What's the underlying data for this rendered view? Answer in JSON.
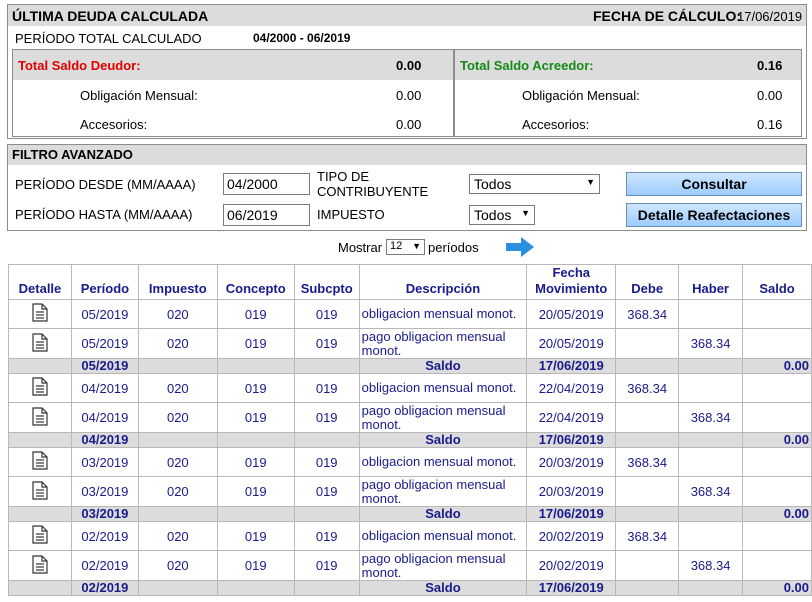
{
  "debt": {
    "title": "ÚLTIMA DEUDA CALCULADA",
    "fecha_label": "FECHA DE CÁLCULO:",
    "fecha_value": "17/06/2019",
    "periodo_label": "PERÍODO TOTAL CALCULADO",
    "periodo_value": "04/2000 - 06/2019",
    "deudor": {
      "label": "Total Saldo Deudor:",
      "total": "0.00",
      "obligacion_label": "Obligación Mensual:",
      "obligacion": "0.00",
      "accesorios_label": "Accesorios:",
      "accesorios": "0.00"
    },
    "acreedor": {
      "label": "Total Saldo Acreedor:",
      "total": "0.16",
      "obligacion_label": "Obligación Mensual:",
      "obligacion": "0.00",
      "accesorios_label": "Accesorios:",
      "accesorios": "0.16"
    },
    "colors": {
      "deudor": "#e00000",
      "acreedor": "#168a16"
    }
  },
  "filter": {
    "title": "FILTRO AVANZADO",
    "desde_label": "PERÍODO DESDE (MM/AAAA)",
    "desde_value": "04/2000",
    "hasta_label": "PERÍODO HASTA (MM/AAAA)",
    "hasta_value": "06/2019",
    "tipo_label_1": "TIPO DE",
    "tipo_label_2": "CONTRIBUYENTE",
    "tipo_value": "Todos",
    "impuesto_label": "IMPUESTO",
    "impuesto_value": "Todos",
    "consultar": "Consultar",
    "reafectaciones": "Detalle Reafectaciones"
  },
  "paging": {
    "mostrar": "Mostrar",
    "count": "12",
    "periodos": "períodos",
    "next_icon": "arrow-right-icon"
  },
  "table": {
    "headers": {
      "detalle": "Detalle",
      "periodo": "Período",
      "impuesto": "Impuesto",
      "concepto": "Concepto",
      "subcpto": "Subcpto",
      "descripcion": "Descripción",
      "fecha_1": "Fecha",
      "fecha_2": "Movimiento",
      "debe": "Debe",
      "haber": "Haber",
      "saldo": "Saldo"
    },
    "groups": [
      {
        "rows": [
          {
            "periodo": "05/2019",
            "impuesto": "020",
            "concepto": "019",
            "subcpto": "019",
            "descripcion": "obligacion mensual monot.",
            "fecha": "20/05/2019",
            "debe": "368.34",
            "haber": "",
            "saldo": ""
          },
          {
            "periodo": "05/2019",
            "impuesto": "020",
            "concepto": "019",
            "subcpto": "019",
            "descripcion": "pago obligacion mensual monot.",
            "fecha": "20/05/2019",
            "debe": "",
            "haber": "368.34",
            "saldo": ""
          }
        ],
        "saldo": {
          "periodo": "05/2019",
          "label": "Saldo",
          "fecha": "17/06/2019",
          "value": "0.00"
        }
      },
      {
        "rows": [
          {
            "periodo": "04/2019",
            "impuesto": "020",
            "concepto": "019",
            "subcpto": "019",
            "descripcion": "obligacion mensual monot.",
            "fecha": "22/04/2019",
            "debe": "368.34",
            "haber": "",
            "saldo": ""
          },
          {
            "periodo": "04/2019",
            "impuesto": "020",
            "concepto": "019",
            "subcpto": "019",
            "descripcion": "pago obligacion mensual monot.",
            "fecha": "22/04/2019",
            "debe": "",
            "haber": "368.34",
            "saldo": ""
          }
        ],
        "saldo": {
          "periodo": "04/2019",
          "label": "Saldo",
          "fecha": "17/06/2019",
          "value": "0.00"
        }
      },
      {
        "rows": [
          {
            "periodo": "03/2019",
            "impuesto": "020",
            "concepto": "019",
            "subcpto": "019",
            "descripcion": "obligacion mensual monot.",
            "fecha": "20/03/2019",
            "debe": "368.34",
            "haber": "",
            "saldo": ""
          },
          {
            "periodo": "03/2019",
            "impuesto": "020",
            "concepto": "019",
            "subcpto": "019",
            "descripcion": "pago obligacion mensual monot.",
            "fecha": "20/03/2019",
            "debe": "",
            "haber": "368.34",
            "saldo": ""
          }
        ],
        "saldo": {
          "periodo": "03/2019",
          "label": "Saldo",
          "fecha": "17/06/2019",
          "value": "0.00"
        }
      },
      {
        "rows": [
          {
            "periodo": "02/2019",
            "impuesto": "020",
            "concepto": "019",
            "subcpto": "019",
            "descripcion": "obligacion mensual monot.",
            "fecha": "20/02/2019",
            "debe": "368.34",
            "haber": "",
            "saldo": ""
          },
          {
            "periodo": "02/2019",
            "impuesto": "020",
            "concepto": "019",
            "subcpto": "019",
            "descripcion": "pago obligacion mensual monot.",
            "fecha": "20/02/2019",
            "debe": "",
            "haber": "368.34",
            "saldo": ""
          }
        ],
        "saldo": {
          "periodo": "02/2019",
          "label": "Saldo",
          "fecha": "17/06/2019",
          "value": "0.00"
        }
      }
    ]
  }
}
